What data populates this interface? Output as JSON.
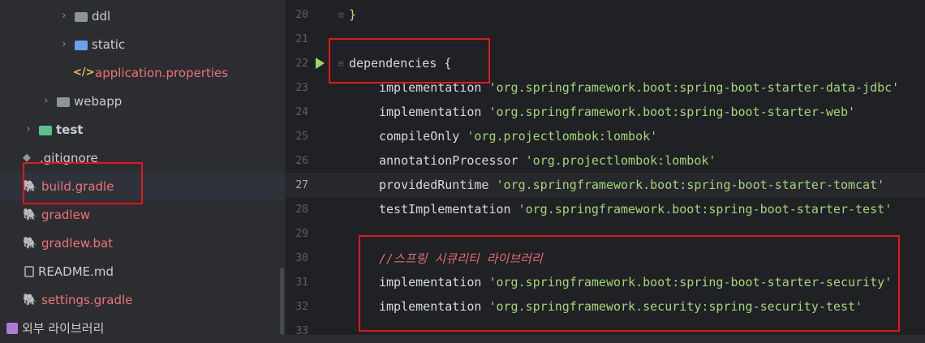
{
  "tree": {
    "items": [
      {
        "label": "ddl"
      },
      {
        "label": "static"
      },
      {
        "label": "application.properties"
      },
      {
        "label": "webapp"
      },
      {
        "label": "test"
      },
      {
        "label": ".gitignore"
      },
      {
        "label": "build.gradle"
      },
      {
        "label": "gradlew"
      },
      {
        "label": "gradlew.bat"
      },
      {
        "label": "README.md"
      },
      {
        "label": "settings.gradle"
      },
      {
        "label": "외부 라이브러리"
      }
    ]
  },
  "editor": {
    "lines": [
      {
        "num": "20",
        "code": "}"
      },
      {
        "num": "21",
        "code": ""
      },
      {
        "num": "22",
        "code": "dependencies {"
      },
      {
        "num": "23",
        "kw": "implementation ",
        "str": "'org.springframework.boot:spring-boot-starter-data-jdbc'"
      },
      {
        "num": "24",
        "kw": "implementation ",
        "str": "'org.springframework.boot:spring-boot-starter-web'"
      },
      {
        "num": "25",
        "kw": "compileOnly ",
        "str": "'org.projectlombok:lombok'"
      },
      {
        "num": "26",
        "kw": "annotationProcessor ",
        "str": "'org.projectlombok:lombok'"
      },
      {
        "num": "27",
        "kw": "providedRuntime ",
        "str": "'org.springframework.boot:spring-boot-starter-tomcat'"
      },
      {
        "num": "28",
        "kw": "testImplementation ",
        "str": "'org.springframework.boot:spring-boot-starter-test'"
      },
      {
        "num": "29",
        "code": ""
      },
      {
        "num": "30",
        "comment": "//스프링 시큐리티 라이브러리"
      },
      {
        "num": "31",
        "kw": "implementation ",
        "str": "'org.springframework.boot:spring-boot-starter-security'"
      },
      {
        "num": "32",
        "kw": "implementation ",
        "str": "'org.springframework.security:spring-security-test'"
      },
      {
        "num": "33",
        "code": ""
      }
    ]
  },
  "colors": {
    "annotation": "#e8141c",
    "string": "#a6d37a",
    "filename_red": "#f07178"
  }
}
